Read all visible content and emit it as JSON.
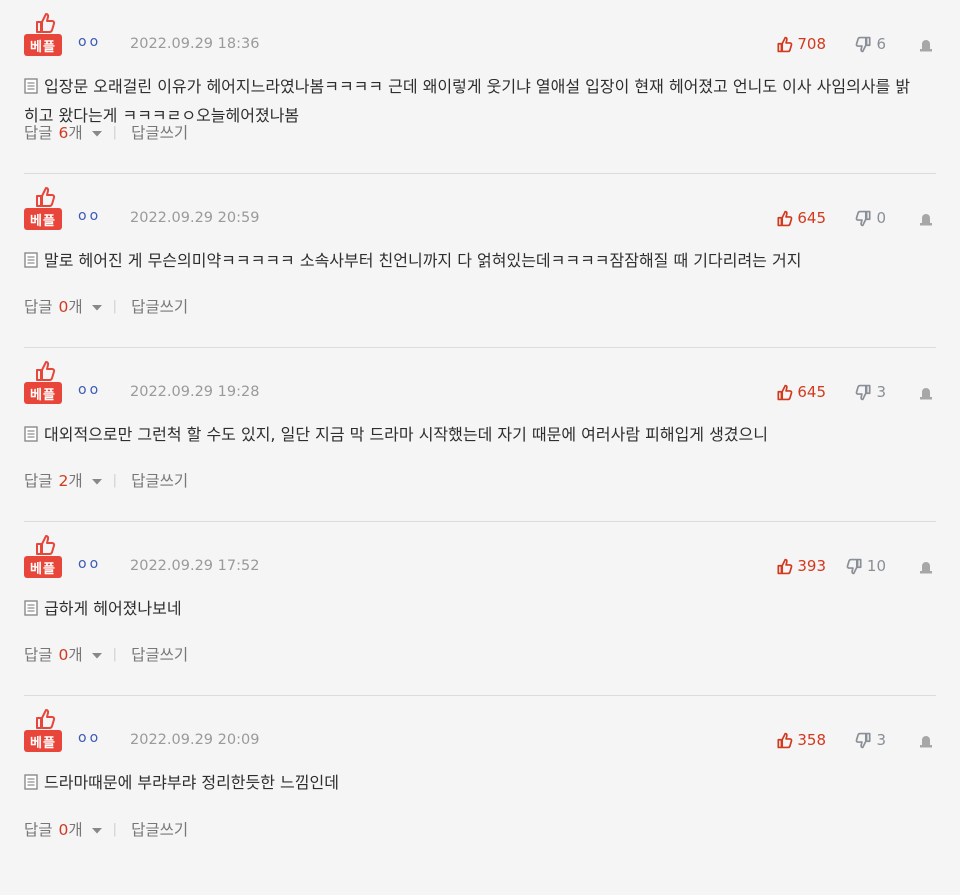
{
  "labels": {
    "best_badge": "베플",
    "reply": "답글",
    "reply_unit": "개",
    "write_reply": "답글쓰기"
  },
  "colors": {
    "accent": "#e8463a",
    "like": "#d2391e",
    "dislike": "#8a8f97",
    "author": "#3b5bb5",
    "date": "#9a9a9a"
  },
  "comments": [
    {
      "author": "oo",
      "date": "2022.09.29 18:36",
      "likes": "708",
      "dislikes": "6",
      "text": "입장문 오래걸린 이유가 헤어지느라였나봄ㅋㅋㅋㅋ 근데 왜이렇게 웃기냐 열애설 입장이 현재 헤어졌고 언니도 이사 사임의사를 밝히고 왔다는게 ㅋㅋㅋㄹㅇ오늘헤어졌나봄",
      "replies": "6"
    },
    {
      "author": "oo",
      "date": "2022.09.29 20:59",
      "likes": "645",
      "dislikes": "0",
      "text": "말로 헤어진 게 무슨의미약ㅋㅋㅋㅋㅋ 소속사부터 친언니까지 다 얽혀있는데ㅋㅋㅋㅋ잠잠해질 때 기다리려는 거지",
      "replies": "0"
    },
    {
      "author": "oo",
      "date": "2022.09.29 19:28",
      "likes": "645",
      "dislikes": "3",
      "text": "대외적으로만 그런척 할 수도 있지, 일단 지금 막 드라마 시작했는데 자기 때문에 여러사람 피해입게 생겼으니",
      "replies": "2"
    },
    {
      "author": "oo",
      "date": "2022.09.29 17:52",
      "likes": "393",
      "dislikes": "10",
      "text": "급하게 헤어졌나보네",
      "replies": "0"
    },
    {
      "author": "oo",
      "date": "2022.09.29 20:09",
      "likes": "358",
      "dislikes": "3",
      "text": "드라마때문에 부랴부랴 정리한듯한 느낌인데",
      "replies": "0"
    }
  ]
}
